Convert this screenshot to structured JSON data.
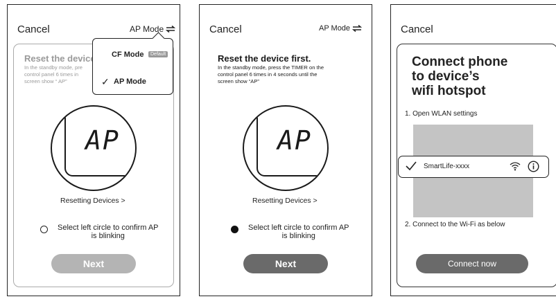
{
  "screen1": {
    "cancel": "Cancel",
    "mode_label": "AP Mode",
    "title": "Reset the device",
    "desc_lines": [
      "In the standby mode, pre",
      "control panel 6 times in",
      "screen show “ AP”"
    ],
    "lcd": "AP",
    "resetting": "Resetting Devices >",
    "confirm_lines": [
      "Select left circle to confirm AP",
      "is blinking"
    ],
    "next": "Next",
    "popup": {
      "cf_mode": "CF Mode",
      "default_badge": "Default",
      "ap_mode": "AP Mode",
      "check": "✓"
    }
  },
  "screen2": {
    "cancel": "Cancel",
    "mode_label": "AP Mode",
    "title": "Reset the device first.",
    "desc_lines": [
      "In the standby mode, press the TIMER on the",
      "control panel 6 times in 4 seconds until the",
      "screen show “AP”"
    ],
    "lcd": "AP",
    "resetting": "Resetting Devices >",
    "confirm_lines": [
      "Select left circle to confirm AP",
      "is blinking"
    ],
    "next": "Next"
  },
  "screen3": {
    "cancel": "Cancel",
    "title_lines": [
      "Connect phone",
      "to device’s",
      "wifi hotspot"
    ],
    "step1": "1. Open WLAN settings",
    "wifi_name": "SmartLife-xxxx",
    "step2": "2. Connect to the Wi-Fi as below",
    "connect": "Connect now"
  },
  "icons": [
    "swap-arrows-icon",
    "check-icon",
    "wifi-icon",
    "info-icon"
  ],
  "colors": {
    "button_enabled": "#6a6a6a",
    "button_disabled": "#b4b4b4",
    "gray_panel": "#c4c4c4"
  }
}
